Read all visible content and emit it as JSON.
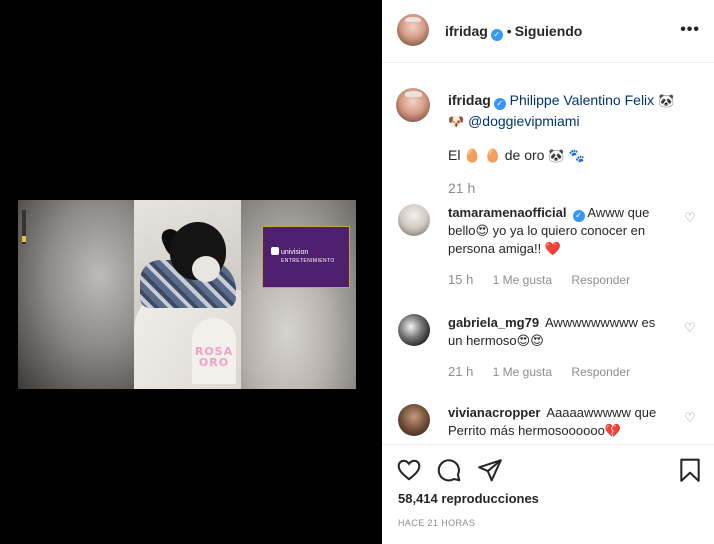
{
  "post": {
    "username": "ifridag",
    "separator": "•",
    "follow_state": "Siguiendo",
    "more_icon": "more-options-icon"
  },
  "video": {
    "overlay_brand": "univision",
    "overlay_sub": "ENTRETENIMIENTO",
    "corner_logo_top": "ROSA",
    "corner_logo_bottom": "ORO"
  },
  "caption": {
    "username": "ifridag",
    "line1_text": "Philippe Valentino Felix",
    "line1_emoji": "🐼",
    "line2_emoji": "🐶",
    "line2_link": "@doggievipmiami",
    "line3_pre": "El",
    "line3_emoji": "🥚 🥚",
    "line3_post": "de oro",
    "line3_emoji_end": "🐼 🐾",
    "time": "21 h"
  },
  "comments": [
    {
      "username": "tamaramenaofficial",
      "verified": true,
      "text": "Awww que bello😍 yo ya lo quiero conocer en persona amiga!! ❤️",
      "time": "15 h",
      "likes": "1 Me gusta",
      "reply": "Responder"
    },
    {
      "username": "gabriela_mg79",
      "verified": false,
      "text": "Awwwwwwwww es un hermoso😍😍",
      "time": "21 h",
      "likes": "1 Me gusta",
      "reply": "Responder"
    },
    {
      "username": "vivianacropper",
      "verified": false,
      "text": "Aaaaawwwww que Perrito más hermosoooooo💔",
      "time": "",
      "likes": "",
      "reply": ""
    }
  ],
  "actions": {
    "like_icon": "heart-icon",
    "comment_icon": "comment-icon",
    "share_icon": "share-icon",
    "save_icon": "bookmark-icon",
    "views_count": "58,414",
    "views_label": "reproducciones",
    "posted": "HACE 21 HORAS"
  },
  "colors": {
    "verified": "#3897f0",
    "muted": "#8e8e8e",
    "text": "#262626",
    "media_bg": "#000000",
    "univision_purple": "#4e1f6e"
  }
}
